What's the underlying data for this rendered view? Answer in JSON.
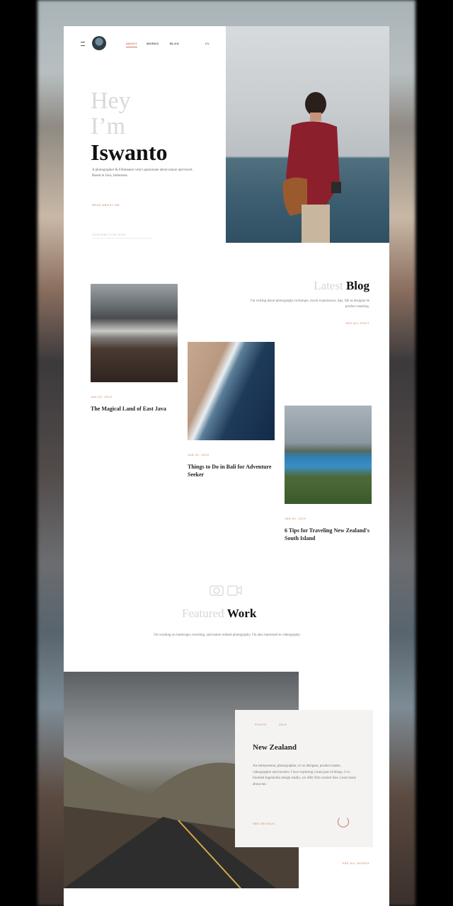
{
  "nav": {
    "links": [
      "ABOUT",
      "WORKS",
      "BLOG"
    ],
    "lang": "EN"
  },
  "hero": {
    "line1": "Hey",
    "line2": "I’m",
    "name": "Iswanto",
    "description": "A photographer & Filmmaker who's passionate about nature and travel. Based in Java, Indonesia.",
    "link": "READ ABOUT ME",
    "input_placeholder": "SUBSCRIBE TO MY NEWS"
  },
  "blog": {
    "title_light": "Latest",
    "title_dark": "Blog",
    "description": "I'm writing about photography technique, travel experiences, tips, life as designer & product marking.",
    "link": "SEE ALL POST",
    "posts": [
      {
        "date": "JAN 02, 2019",
        "title": "The Magical Land of East Java"
      },
      {
        "date": "JAN 02, 2019",
        "title": "Things to Do in Bali for Adventure Seeker"
      },
      {
        "date": "JAN 02, 2019",
        "title": "6 Tips for Traveling New Zealand's South Island"
      }
    ]
  },
  "featured": {
    "title_light": "Featured",
    "title_dark": "Work",
    "description": "I'm working on landscape, traveling, and nature related photography. I'm also interested in videography.",
    "card": {
      "tag1": "PHOTO",
      "tag2": "2019",
      "title": "New Zealand",
      "description": "An entrepreneur, photographer, or ux designer, product maker, videographer and traveler. I love exploring visual part of things. I co-founded Ingeniodia design studio, we offer film custom fees. Learn more about me.",
      "link": "SEE DETAILS"
    },
    "all_link": "SEE ALL WORKS"
  },
  "colors": {
    "accent": "#c97a5c",
    "text_dark": "#111111",
    "text_light": "#d6d6d6"
  }
}
